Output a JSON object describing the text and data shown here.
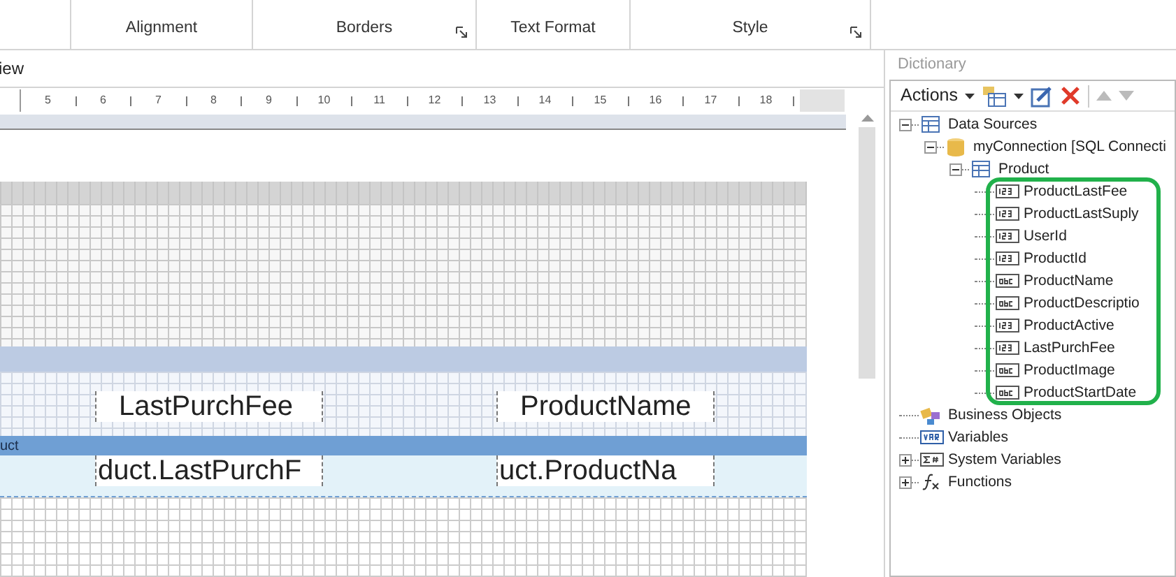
{
  "ribbon": {
    "groups": [
      {
        "label": "Alignment",
        "launcher": false
      },
      {
        "label": "Borders",
        "launcher": true
      },
      {
        "label": "Text Format",
        "launcher": false
      },
      {
        "label": "Style",
        "launcher": true
      }
    ]
  },
  "designer": {
    "tab": "iew",
    "ruler": [
      "5",
      "6",
      "7",
      "8",
      "9",
      "10",
      "11",
      "12",
      "13",
      "14",
      "15",
      "16",
      "17",
      "18"
    ],
    "header_band": {
      "cells": [
        "LastPurchFee",
        "ProductName"
      ]
    },
    "data_band": {
      "label": "uct",
      "cells": [
        "duct.LastPurchF",
        "uct.ProductNa"
      ]
    }
  },
  "dictionary": {
    "title": "Dictionary",
    "actions": "Actions",
    "tree": [
      {
        "label": "Data Sources",
        "kind": "folder",
        "expanded": true,
        "children": [
          {
            "label": "myConnection [SQL Connecti",
            "kind": "connection",
            "expanded": true,
            "children": [
              {
                "label": "Product",
                "kind": "table",
                "expanded": true,
                "children": [
                  {
                    "label": "ProductLastFee",
                    "kind": "number"
                  },
                  {
                    "label": "ProductLastSuply",
                    "kind": "number"
                  },
                  {
                    "label": "UserId",
                    "kind": "number"
                  },
                  {
                    "label": "ProductId",
                    "kind": "number"
                  },
                  {
                    "label": "ProductName",
                    "kind": "text"
                  },
                  {
                    "label": "ProductDescriptio",
                    "kind": "text"
                  },
                  {
                    "label": "ProductActive",
                    "kind": "number"
                  },
                  {
                    "label": "LastPurchFee",
                    "kind": "number"
                  },
                  {
                    "label": "ProductImage",
                    "kind": "text"
                  },
                  {
                    "label": "ProductStartDate",
                    "kind": "text"
                  }
                ]
              }
            ]
          }
        ]
      },
      {
        "label": "Business Objects",
        "kind": "objects"
      },
      {
        "label": "Variables",
        "kind": "variables"
      },
      {
        "label": "System Variables",
        "kind": "sysvars",
        "expanded": false
      },
      {
        "label": "Functions",
        "kind": "functions",
        "expanded": false
      }
    ]
  }
}
